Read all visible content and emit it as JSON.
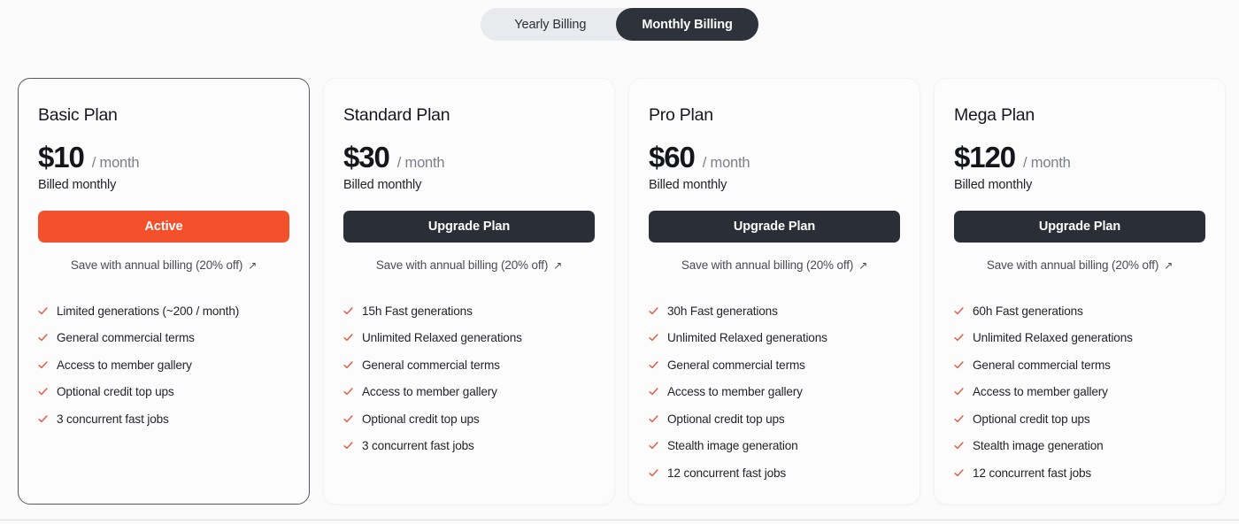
{
  "billing_toggle": {
    "options": [
      {
        "label": "Yearly Billing",
        "selected": false
      },
      {
        "label": "Monthly Billing",
        "selected": true
      }
    ]
  },
  "colors": {
    "page_background": "#FBFBFB",
    "card_background": "#FCFCFC",
    "active_card_border": "#55585E",
    "cta_dark": "#2A2E36",
    "cta_active_orange": "#F4502B",
    "toggle_track": "#E9EAEE",
    "toggle_selected": "#2E323A",
    "check_mark": "#E8503A",
    "muted_text": "#7B7F89",
    "divider": "#D9DADE"
  },
  "plans": [
    {
      "name": "Basic Plan",
      "price": "$10",
      "period": "/ month",
      "billed": "Billed monthly",
      "cta_label": "Active",
      "cta_style": "orange",
      "is_active": true,
      "save_link": "Save with annual billing (20% off)",
      "save_link_icon": "arrow-up-right-icon",
      "features": [
        "Limited generations (~200 / month)",
        "General commercial terms",
        "Access to member gallery",
        "Optional credit top ups",
        "3 concurrent fast jobs"
      ]
    },
    {
      "name": "Standard Plan",
      "price": "$30",
      "period": "/ month",
      "billed": "Billed monthly",
      "cta_label": "Upgrade Plan",
      "cta_style": "dark",
      "is_active": false,
      "save_link": "Save with annual billing (20% off)",
      "save_link_icon": "arrow-up-right-icon",
      "features": [
        "15h Fast generations",
        "Unlimited Relaxed generations",
        "General commercial terms",
        "Access to member gallery",
        "Optional credit top ups",
        "3 concurrent fast jobs"
      ]
    },
    {
      "name": "Pro Plan",
      "price": "$60",
      "period": "/ month",
      "billed": "Billed monthly",
      "cta_label": "Upgrade Plan",
      "cta_style": "dark",
      "is_active": false,
      "save_link": "Save with annual billing (20% off)",
      "save_link_icon": "arrow-up-right-icon",
      "features": [
        "30h Fast generations",
        "Unlimited Relaxed generations",
        "General commercial terms",
        "Access to member gallery",
        "Optional credit top ups",
        "Stealth image generation",
        "12 concurrent fast jobs"
      ]
    },
    {
      "name": "Mega Plan",
      "price": "$120",
      "period": "/ month",
      "billed": "Billed monthly",
      "cta_label": "Upgrade Plan",
      "cta_style": "dark",
      "is_active": false,
      "save_link": "Save with annual billing (20% off)",
      "save_link_icon": "arrow-up-right-icon",
      "features": [
        "60h Fast generations",
        "Unlimited Relaxed generations",
        "General commercial terms",
        "Access to member gallery",
        "Optional credit top ups",
        "Stealth image generation",
        "12 concurrent fast jobs"
      ]
    }
  ]
}
